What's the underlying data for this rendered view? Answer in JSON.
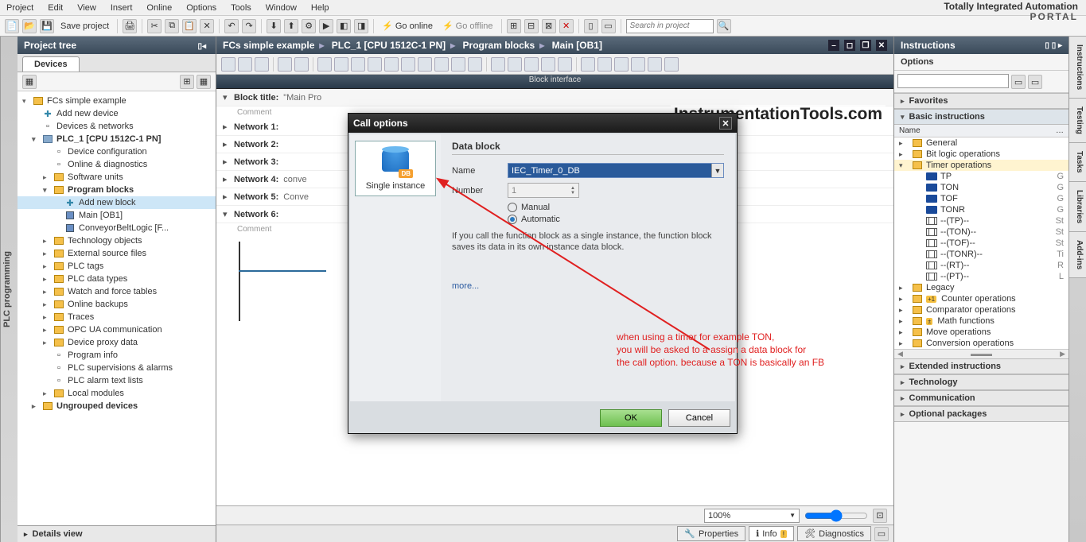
{
  "menu": {
    "items": [
      "Project",
      "Edit",
      "View",
      "Insert",
      "Online",
      "Options",
      "Tools",
      "Window",
      "Help"
    ]
  },
  "brand": {
    "line1": "Totally Integrated Automation",
    "line2": "PORTAL"
  },
  "toolbar": {
    "save_label": "Save project",
    "go_online": "Go online",
    "go_offline": "Go offline",
    "search_placeholder": "Search in project"
  },
  "left_strip": {
    "label": "PLC programming"
  },
  "project_tree": {
    "title": "Project tree",
    "tab": "Devices",
    "items": [
      {
        "lvl": 0,
        "arrow": "▾",
        "icon": "folder",
        "text": "FCs simple example",
        "bold": false
      },
      {
        "lvl": 1,
        "arrow": "",
        "icon": "add",
        "text": "Add new device",
        "bold": false
      },
      {
        "lvl": 1,
        "arrow": "",
        "icon": "net",
        "text": "Devices & networks",
        "bold": false
      },
      {
        "lvl": 1,
        "arrow": "▾",
        "icon": "device",
        "text": "PLC_1 [CPU 1512C-1 PN]",
        "bold": true
      },
      {
        "lvl": 2,
        "arrow": "",
        "icon": "cfg",
        "text": "Device configuration",
        "bold": false
      },
      {
        "lvl": 2,
        "arrow": "",
        "icon": "diag",
        "text": "Online & diagnostics",
        "bold": false
      },
      {
        "lvl": 2,
        "arrow": "▸",
        "icon": "folder",
        "text": "Software units",
        "bold": false
      },
      {
        "lvl": 2,
        "arrow": "▾",
        "icon": "folder",
        "text": "Program blocks",
        "bold": true
      },
      {
        "lvl": 3,
        "arrow": "",
        "icon": "add",
        "text": "Add new block",
        "bold": false,
        "selected": true
      },
      {
        "lvl": 3,
        "arrow": "",
        "icon": "block",
        "text": "Main [OB1]",
        "bold": false
      },
      {
        "lvl": 3,
        "arrow": "",
        "icon": "block",
        "text": "ConveyorBeltLogic [F...",
        "bold": false
      },
      {
        "lvl": 2,
        "arrow": "▸",
        "icon": "folder",
        "text": "Technology objects",
        "bold": false
      },
      {
        "lvl": 2,
        "arrow": "▸",
        "icon": "folder",
        "text": "External source files",
        "bold": false
      },
      {
        "lvl": 2,
        "arrow": "▸",
        "icon": "folder",
        "text": "PLC tags",
        "bold": false
      },
      {
        "lvl": 2,
        "arrow": "▸",
        "icon": "folder",
        "text": "PLC data types",
        "bold": false
      },
      {
        "lvl": 2,
        "arrow": "▸",
        "icon": "folder",
        "text": "Watch and force tables",
        "bold": false
      },
      {
        "lvl": 2,
        "arrow": "▸",
        "icon": "folder",
        "text": "Online backups",
        "bold": false
      },
      {
        "lvl": 2,
        "arrow": "▸",
        "icon": "folder",
        "text": "Traces",
        "bold": false
      },
      {
        "lvl": 2,
        "arrow": "▸",
        "icon": "folder",
        "text": "OPC UA communication",
        "bold": false
      },
      {
        "lvl": 2,
        "arrow": "▸",
        "icon": "folder",
        "text": "Device proxy data",
        "bold": false
      },
      {
        "lvl": 2,
        "arrow": "",
        "icon": "info",
        "text": "Program info",
        "bold": false
      },
      {
        "lvl": 2,
        "arrow": "",
        "icon": "sup",
        "text": "PLC supervisions & alarms",
        "bold": false
      },
      {
        "lvl": 2,
        "arrow": "",
        "icon": "txt",
        "text": "PLC alarm text lists",
        "bold": false
      },
      {
        "lvl": 2,
        "arrow": "▸",
        "icon": "folder",
        "text": "Local modules",
        "bold": false
      },
      {
        "lvl": 1,
        "arrow": "▸",
        "icon": "folder",
        "text": "Ungrouped devices",
        "bold": true
      }
    ]
  },
  "details_view": {
    "label": "Details view"
  },
  "breadcrumb": {
    "parts": [
      "FCs simple example",
      "PLC_1 [CPU 1512C-1 PN]",
      "Program blocks",
      "Main [OB1]"
    ]
  },
  "watermark": "InstrumentationTools.com",
  "block_interface": "Block interface",
  "networks": {
    "block_title_label": "Block title:",
    "block_title_value": "\"Main Pro",
    "comment": "Comment",
    "list": [
      {
        "n": "Network 1:",
        "d": ""
      },
      {
        "n": "Network 2:",
        "d": ""
      },
      {
        "n": "Network 3:",
        "d": ""
      },
      {
        "n": "Network 4:",
        "d": "conve"
      },
      {
        "n": "Network 5:",
        "d": "Conve"
      },
      {
        "n": "Network 6:",
        "d": "",
        "open": true
      }
    ]
  },
  "zoom": "100%",
  "bottom_tabs": {
    "properties": "Properties",
    "info": "Info",
    "diagnostics": "Diagnostics"
  },
  "instructions": {
    "title": "Instructions",
    "options": "Options",
    "favorites": "Favorites",
    "basic": "Basic instructions",
    "name_col": "Name",
    "groups": [
      {
        "lvl": 0,
        "ar": "▸",
        "ic": "fold",
        "t": "General"
      },
      {
        "lvl": 0,
        "ar": "▸",
        "ic": "fold",
        "t": "Bit logic operations"
      },
      {
        "lvl": 0,
        "ar": "▾",
        "ic": "fold",
        "t": "Timer operations",
        "hl": true
      },
      {
        "lvl": 1,
        "ar": "",
        "ic": "timer",
        "t": "TP",
        "r": "G"
      },
      {
        "lvl": 1,
        "ar": "",
        "ic": "timer",
        "t": "TON",
        "r": "G"
      },
      {
        "lvl": 1,
        "ar": "",
        "ic": "timer",
        "t": "TOF",
        "r": "G"
      },
      {
        "lvl": 1,
        "ar": "",
        "ic": "timer",
        "t": "TONR",
        "r": "G"
      },
      {
        "lvl": 1,
        "ar": "",
        "ic": "brk",
        "t": "--(TP)--",
        "r": "St"
      },
      {
        "lvl": 1,
        "ar": "",
        "ic": "brk",
        "t": "--(TON)--",
        "r": "St"
      },
      {
        "lvl": 1,
        "ar": "",
        "ic": "brk",
        "t": "--(TOF)--",
        "r": "St"
      },
      {
        "lvl": 1,
        "ar": "",
        "ic": "brk",
        "t": "--(TONR)--",
        "r": "Ti"
      },
      {
        "lvl": 1,
        "ar": "",
        "ic": "brk",
        "t": "--(RT)--",
        "r": "R"
      },
      {
        "lvl": 1,
        "ar": "",
        "ic": "brk",
        "t": "--(PT)--",
        "r": "L"
      },
      {
        "lvl": 0,
        "ar": "▸",
        "ic": "fold",
        "t": "Legacy"
      },
      {
        "lvl": 0,
        "ar": "▸",
        "ic": "fold",
        "t": "Counter operations",
        "badge": "+1"
      },
      {
        "lvl": 0,
        "ar": "▸",
        "ic": "fold",
        "t": "Comparator operations"
      },
      {
        "lvl": 0,
        "ar": "▸",
        "ic": "fold",
        "t": "Math functions",
        "badge": "±"
      },
      {
        "lvl": 0,
        "ar": "▸",
        "ic": "fold",
        "t": "Move operations"
      },
      {
        "lvl": 0,
        "ar": "▸",
        "ic": "fold",
        "t": "Conversion operations"
      }
    ],
    "extended": "Extended instructions",
    "technology": "Technology",
    "communication": "Communication",
    "optional": "Optional packages"
  },
  "right_tabs": [
    "Instructions",
    "Testing",
    "Tasks",
    "Libraries",
    "Add-ins"
  ],
  "dialog": {
    "title": "Call options",
    "option_label": "Single instance",
    "section": "Data block",
    "name_label": "Name",
    "name_value": "IEC_Timer_0_DB",
    "number_label": "Number",
    "number_value": "1",
    "manual": "Manual",
    "automatic": "Automatic",
    "desc": "If you call the function block as a single instance, the function block saves its data in its own instance data block.",
    "more": "more...",
    "ok": "OK",
    "cancel": "Cancel"
  },
  "annotation": {
    "l1": "when using a timer for example TON,",
    "l2": "you will be asked to a assign a data block for",
    "l3": "the call option. because a TON is basically an FB"
  }
}
